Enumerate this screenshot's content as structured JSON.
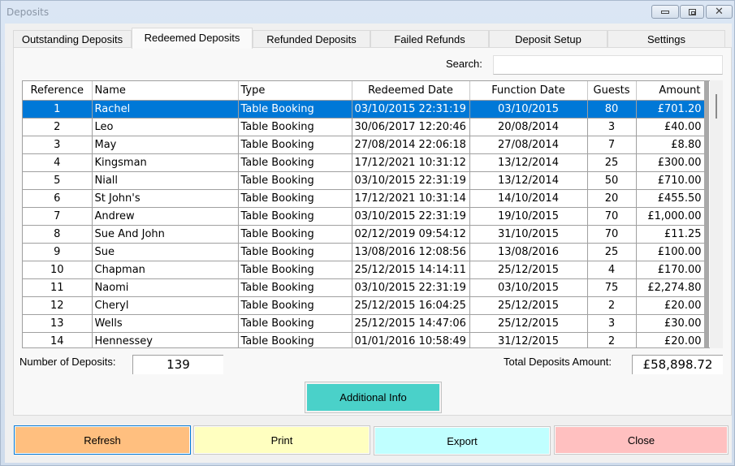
{
  "window": {
    "title": "Deposits",
    "controls": {
      "minimize": "minimize",
      "maximize": "maximize",
      "close": "close"
    }
  },
  "tabs": [
    {
      "label": "Outstanding Deposits",
      "active": false
    },
    {
      "label": "Redeemed Deposits",
      "active": true
    },
    {
      "label": "Refunded Deposits",
      "active": false
    },
    {
      "label": "Failed Refunds",
      "active": false
    },
    {
      "label": "Deposit Setup",
      "active": false
    },
    {
      "label": "Settings",
      "active": false
    }
  ],
  "search": {
    "label": "Search:",
    "value": "",
    "placeholder": ""
  },
  "table": {
    "columns": [
      "Reference",
      "Name",
      "Type",
      "Redeemed Date",
      "Function Date",
      "Guests",
      "Amount"
    ],
    "selected_row": 0,
    "rows": [
      [
        "1",
        "Rachel",
        "Table Booking",
        "03/10/2015 22:31:19",
        "03/10/2015",
        "80",
        "£701.20"
      ],
      [
        "2",
        "Leo",
        "Table Booking",
        "30/06/2017 12:20:46",
        "20/08/2014",
        "3",
        "£40.00"
      ],
      [
        "3",
        "May",
        "Table Booking",
        "27/08/2014 22:06:18",
        "27/08/2014",
        "7",
        "£8.80"
      ],
      [
        "4",
        "Kingsman",
        "Table Booking",
        "17/12/2021 10:31:12",
        "13/12/2014",
        "25",
        "£300.00"
      ],
      [
        "5",
        "Niall",
        "Table Booking",
        "03/10/2015 22:31:19",
        "13/12/2014",
        "50",
        "£710.00"
      ],
      [
        "6",
        "St John's",
        "Table Booking",
        "17/12/2021 10:31:14",
        "14/10/2014",
        "20",
        "£455.50"
      ],
      [
        "7",
        "Andrew",
        "Table Booking",
        "03/10/2015 22:31:19",
        "19/10/2015",
        "70",
        "£1,000.00"
      ],
      [
        "8",
        "Sue And John",
        "Table Booking",
        "02/12/2019 09:54:12",
        "31/10/2015",
        "70",
        "£11.25"
      ],
      [
        "9",
        "Sue",
        "Table Booking",
        "13/08/2016 12:08:56",
        "13/08/2016",
        "25",
        "£100.00"
      ],
      [
        "10",
        "Chapman",
        "Table Booking",
        "25/12/2015 14:14:11",
        "25/12/2015",
        "4",
        "£170.00"
      ],
      [
        "11",
        "Naomi",
        "Table Booking",
        "03/10/2015 22:31:19",
        "03/10/2015",
        "75",
        "£2,274.80"
      ],
      [
        "12",
        "Cheryl",
        "Table Booking",
        "25/12/2015 16:04:25",
        "25/12/2015",
        "2",
        "£20.00"
      ],
      [
        "13",
        "Wells",
        "Table Booking",
        "25/12/2015 14:47:06",
        "25/12/2015",
        "3",
        "£30.00"
      ],
      [
        "14",
        "Hennessey",
        "Table Booking",
        "01/01/2016 10:58:49",
        "31/12/2015",
        "2",
        "£20.00"
      ]
    ]
  },
  "summary": {
    "count_label": "Number of Deposits:",
    "count_value": "139",
    "total_label": "Total Deposits Amount:",
    "total_value": "£58,898.72"
  },
  "buttons": {
    "additional_info": "Additional Info",
    "refresh": "Refresh",
    "print": "Print",
    "export": "Export",
    "close": "Close"
  },
  "colors": {
    "selection": "#0078d7",
    "additional_info": "#4ad1c9",
    "refresh": "#ffbf7f",
    "print": "#ffffc0",
    "export": "#c0ffff",
    "close": "#ffc0c0"
  }
}
